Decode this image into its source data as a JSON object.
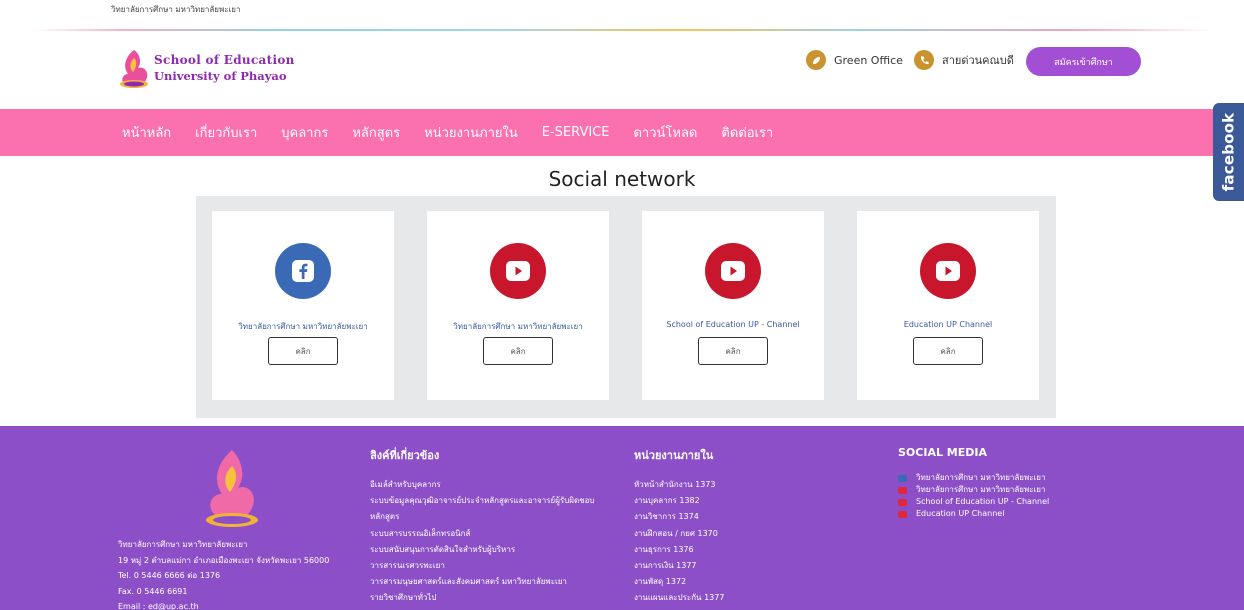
{
  "topbar": {
    "title": "วิทยาลัยการศึกษา มหาวิทยาลัยพะเยา"
  },
  "header": {
    "logo_line1": "School of Education",
    "logo_line2": "University of Phayao",
    "links": [
      {
        "label": "Green Office",
        "icon": "leaf-icon"
      },
      {
        "label": "สายด่วนคณบดี",
        "icon": "phone-icon"
      }
    ],
    "apply_label": "สมัครเข้าศึกษา",
    "accent_color": "#a24fd6"
  },
  "nav": {
    "color": "#fb70ae",
    "items": [
      "หน้าหลัก",
      "เกี่ยวกับเรา",
      "บุคลากร",
      "หลักสูตร",
      "หน่วยงานภายใน",
      "E-SERVICE",
      "ดาวน์โหลด",
      "ติดต่อเรา"
    ]
  },
  "facebook_tab": {
    "label": "facebook"
  },
  "social_section": {
    "title": "Social network",
    "cards": [
      {
        "label": "วิทยาลัยการศึกษา มหาวิทยาลัยพะเยา",
        "icon": "facebook-icon",
        "button": "คลิก"
      },
      {
        "label": "วิทยาลัยการศึกษา มหาวิทยาลัยพะเยา",
        "icon": "youtube-icon",
        "button": "คลิก"
      },
      {
        "label": "School of Education UP - Channel",
        "icon": "youtube-icon",
        "button": "คลิก"
      },
      {
        "label": "Education UP Channel",
        "icon": "youtube-icon",
        "button": "คลิก"
      }
    ]
  },
  "footer": {
    "color": "#8c4fc8",
    "address": [
      "วิทยาลัยการศึกษา มหาวิทยาลัยพะเยา",
      "19 หมู่ 2 ตำบลแม่กา อำเภอเมืองพะเยา จังหวัดพะเยา 56000",
      "Tel. 0 5446 6666 ต่อ 1376",
      "Fax. 0 5446 6691",
      "Email : ed@up.ac.th"
    ],
    "links_title": "ลิงค์ที่เกี่ยวข้อง",
    "links": [
      "อีเมล์สำหรับบุคลากร",
      "ระบบข้อมูลคุณวุฒิอาจารย์ประจำหลักสูตรและอาจารย์ผู้รับผิดชอบ",
      "หลักสูตร",
      "ระบบสารบรรณอิเล็กทรอนิกส์",
      "ระบบสนับสนุนการตัดสินใจสำหรับผู้บริหาร",
      "วารสารนเรศวรพะเยา",
      "วารสารมนุษยศาสตร์และสังคมศาสตร์ มหาวิทยาลัยพะเยา",
      "รายวิชาศึกษาทั่วไป"
    ],
    "units_title": "หน่วยงานภายใน",
    "units": [
      "หัวหน้าสำนักงาน 1373",
      "งานบุคลากร 1382",
      "งานวิชาการ 1374",
      "งานฝึกสอน / กยศ 1370",
      "งานธุรการ 1376",
      "งานการเงิน 1377",
      "งานพัสดุ 1372",
      "งานแผนและประกัน 1377"
    ],
    "social_title": "SOCIAL MEDIA",
    "social": [
      {
        "label": "วิทยาลัยการศึกษา มหาวิทยาลัยพะเยา",
        "icon": "facebook-icon"
      },
      {
        "label": "วิทยาลัยการศึกษา มหาวิทยาลัยพะเยา",
        "icon": "youtube-icon"
      },
      {
        "label": "School of Education UP - Channel",
        "icon": "youtube-icon"
      },
      {
        "label": "Education UP Channel",
        "icon": "youtube-icon"
      }
    ]
  }
}
